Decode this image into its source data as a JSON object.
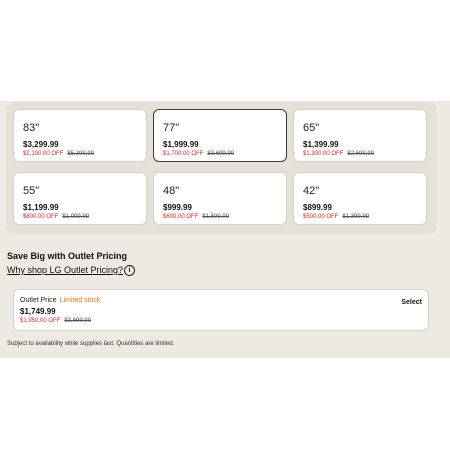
{
  "sizes": [
    {
      "size": "83\"",
      "price": "$3,299.99",
      "discount": "$2,100.00 OFF",
      "original": "$5,399.99",
      "selected": false
    },
    {
      "size": "77\"",
      "price": "$1,999.99",
      "discount": "$1,700.00 OFF",
      "original": "$3,699.99",
      "selected": true
    },
    {
      "size": "65\"",
      "price": "$1,399.99",
      "discount": "$1,300.00 OFF",
      "original": "$2,699.99",
      "selected": false
    },
    {
      "size": "55\"",
      "price": "$1,199.99",
      "discount": "$800.00 OFF",
      "original": "$1,999.99",
      "selected": false
    },
    {
      "size": "48\"",
      "price": "$999.99",
      "discount": "$600.00 OFF",
      "original": "$1,599.99",
      "selected": false
    },
    {
      "size": "42\"",
      "price": "$899.99",
      "discount": "$500.00 OFF",
      "original": "$1,399.99",
      "selected": false
    }
  ],
  "outlet": {
    "title": "Save Big with Outlet Pricing",
    "why_link": "Why shop LG Outlet Pricing?",
    "info_icon": "i",
    "label": "Outlet Price",
    "stock": "Limited stock",
    "price": "$1,749.99",
    "discount": "$1,950.00 OFF",
    "original": "$3,699.99",
    "select_label": "Select"
  },
  "footnote": "Subject to availability while supplies last. Quantities are limited.",
  "colors": {
    "discount": "#d02a2a",
    "stock": "#e07020",
    "panel_bg": "#ede9e3"
  }
}
